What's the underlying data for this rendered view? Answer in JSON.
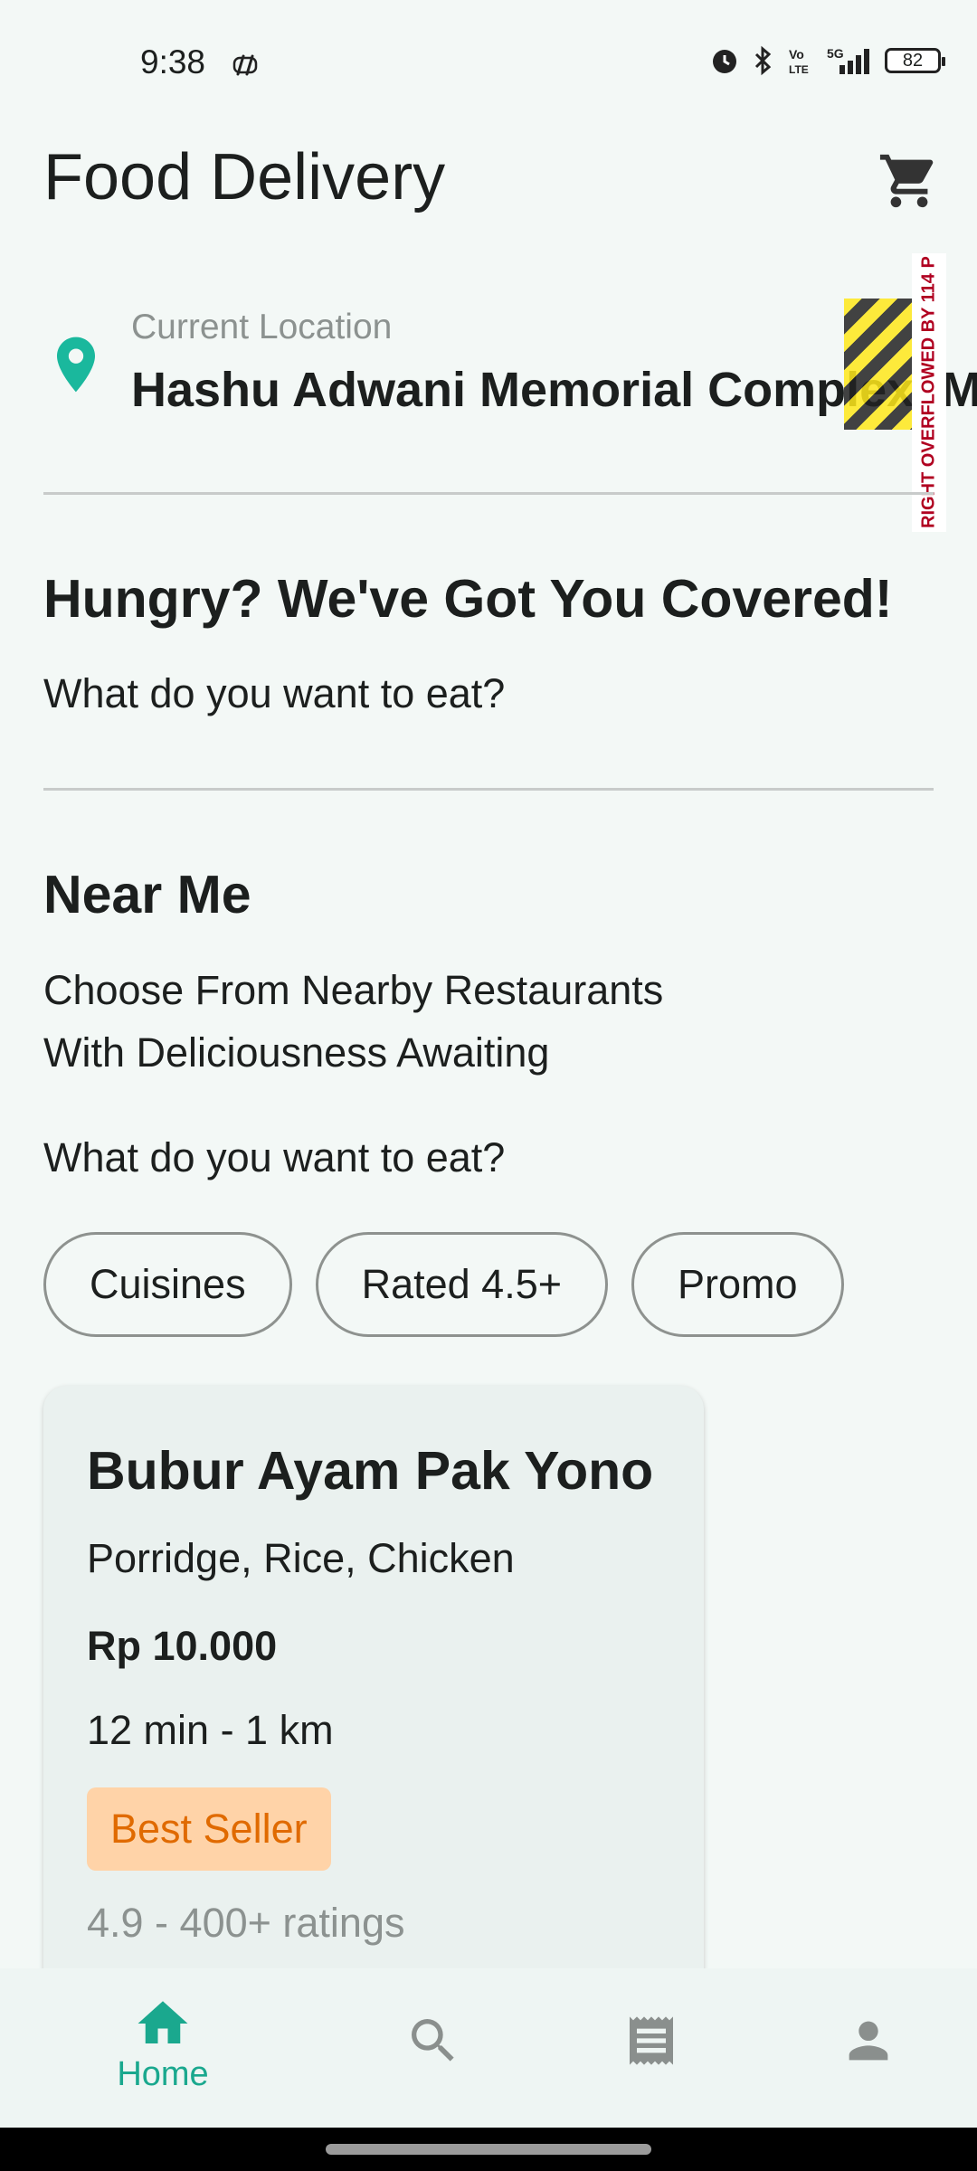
{
  "status_bar": {
    "time": "9:38",
    "battery": "82",
    "icons": [
      "sync-icon",
      "alarm-icon",
      "bluetooth-icon",
      "volte-icon",
      "5g-signal-icon",
      "battery-icon"
    ]
  },
  "header": {
    "title": "Food Delivery",
    "cart_icon": "cart-icon"
  },
  "location": {
    "label": "Current Location",
    "value": "Hashu Adwani Memorial Complex, Mu",
    "overflow_warning": "RIGHT OVERFLOWED BY 114 P"
  },
  "hero": {
    "title": "Hungry? We've Got You Covered!",
    "subtitle": "What do you want to eat?"
  },
  "near_me": {
    "title": "Near Me",
    "description_line1": "Choose From Nearby Restaurants",
    "description_line2": "With Deliciousness Awaiting",
    "prompt": "What do you want to eat?",
    "filters": [
      "Cuisines",
      "Rated 4.5+",
      "Promo"
    ]
  },
  "restaurant_card": {
    "name": "Bubur Ayam Pak Yono",
    "tags": "Porridge, Rice, Chicken",
    "price": "Rp 10.000",
    "eta": "12 min - 1 km",
    "badge": "Best Seller",
    "rating": "4.9 - 400+ ratings"
  },
  "bottom_nav": {
    "items": [
      {
        "label": "Home",
        "icon": "home-icon",
        "active": true
      },
      {
        "label": "",
        "icon": "search-icon",
        "active": false
      },
      {
        "label": "",
        "icon": "receipt-icon",
        "active": false
      },
      {
        "label": "",
        "icon": "profile-icon",
        "active": false
      }
    ],
    "active_color": "#1aa88e",
    "inactive_color": "#8a8f8d"
  },
  "colors": {
    "accent": "#1aa88e",
    "badge_bg": "#ffd3a8",
    "badge_text": "#e06a00",
    "background": "#f3f8f6"
  }
}
